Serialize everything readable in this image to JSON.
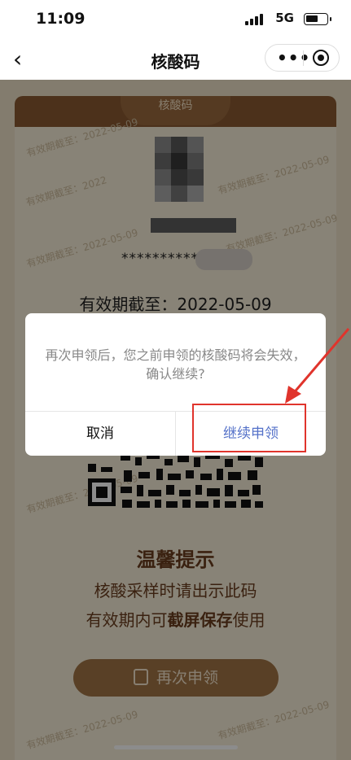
{
  "status_bar": {
    "time": "11:09",
    "network": "5G"
  },
  "nav": {
    "back_icon": "chevron-left-icon",
    "title": "核酸码",
    "more_icon": "more-dots-icon",
    "close_icon": "record-close-icon"
  },
  "card": {
    "header_tab": "核酸码",
    "masked_id": "**************",
    "validity": "有效期截至：2022-05-09",
    "watermarks": [
      "有效期截至：2022-05-09",
      "有效期截至：2022",
      "有效期截至：2022-05-09",
      "有效期截至：2022-05-09",
      "有效期截至：2022-05-09",
      "有效期截至：2022-05-09",
      "有效期截至：2022-05-09",
      "有效期截至：2022-05-09"
    ],
    "tips_title": "温馨提示",
    "tips_line1": "核酸采样时请出示此码",
    "tips_line2_pre": "有效期内可",
    "tips_line2_bold": "截屏保存",
    "tips_line2_post": "使用",
    "reapply_button": "再次申领"
  },
  "dialog": {
    "message": "再次申领后，您之前申领的核酸码将会失效，确认继续?",
    "cancel": "取消",
    "confirm": "继续申领"
  },
  "colors": {
    "brand_brown": "#8a5a32",
    "confirm_blue": "#5572c9",
    "annotation_red": "#e0342c"
  }
}
